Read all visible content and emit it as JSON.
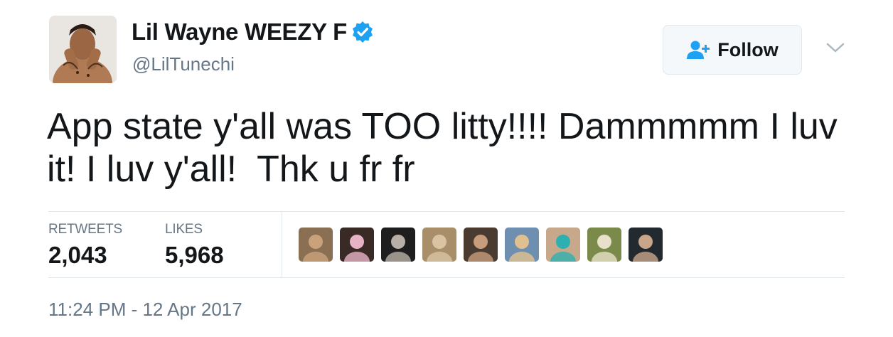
{
  "user": {
    "display_name": "Lil Wayne WEEZY F",
    "handle": "@LilTunechi",
    "verified": true,
    "avatar_icon": "profile-photo"
  },
  "follow_button": {
    "label": "Follow",
    "icon": "add-user-icon",
    "accent_color": "#1da1f2"
  },
  "menu": {
    "icon": "chevron-down-icon"
  },
  "tweet": {
    "text": "App state y'all was TOO litty!!!! Dammmmm I luv it! I luv y'all!  Thk u fr fr"
  },
  "stats": {
    "retweets_label": "RETWEETS",
    "retweets_value": "2,043",
    "likes_label": "LIKES",
    "likes_value": "5,968"
  },
  "likers": [
    {
      "name": "liker-avatar-1",
      "colors": [
        "#8a6f52",
        "#c9a27c"
      ]
    },
    {
      "name": "liker-avatar-2",
      "colors": [
        "#3a2a26",
        "#e7b3c4"
      ]
    },
    {
      "name": "liker-avatar-3",
      "colors": [
        "#1e1e1e",
        "#b8b0a8"
      ]
    },
    {
      "name": "liker-avatar-4",
      "colors": [
        "#a88f6a",
        "#d9c3a3"
      ]
    },
    {
      "name": "liker-avatar-5",
      "colors": [
        "#4a3b30",
        "#c79c7c"
      ]
    },
    {
      "name": "liker-avatar-6",
      "colors": [
        "#6f8fb0",
        "#e0c090"
      ]
    },
    {
      "name": "liker-avatar-7",
      "colors": [
        "#c8a88a",
        "#2fb0b0"
      ]
    },
    {
      "name": "liker-avatar-8",
      "colors": [
        "#7a8a4a",
        "#e8e0c8"
      ]
    },
    {
      "name": "liker-avatar-9",
      "colors": [
        "#222a30",
        "#c9a58a"
      ]
    }
  ],
  "timestamp": "11:24 PM - 12 Apr 2017"
}
